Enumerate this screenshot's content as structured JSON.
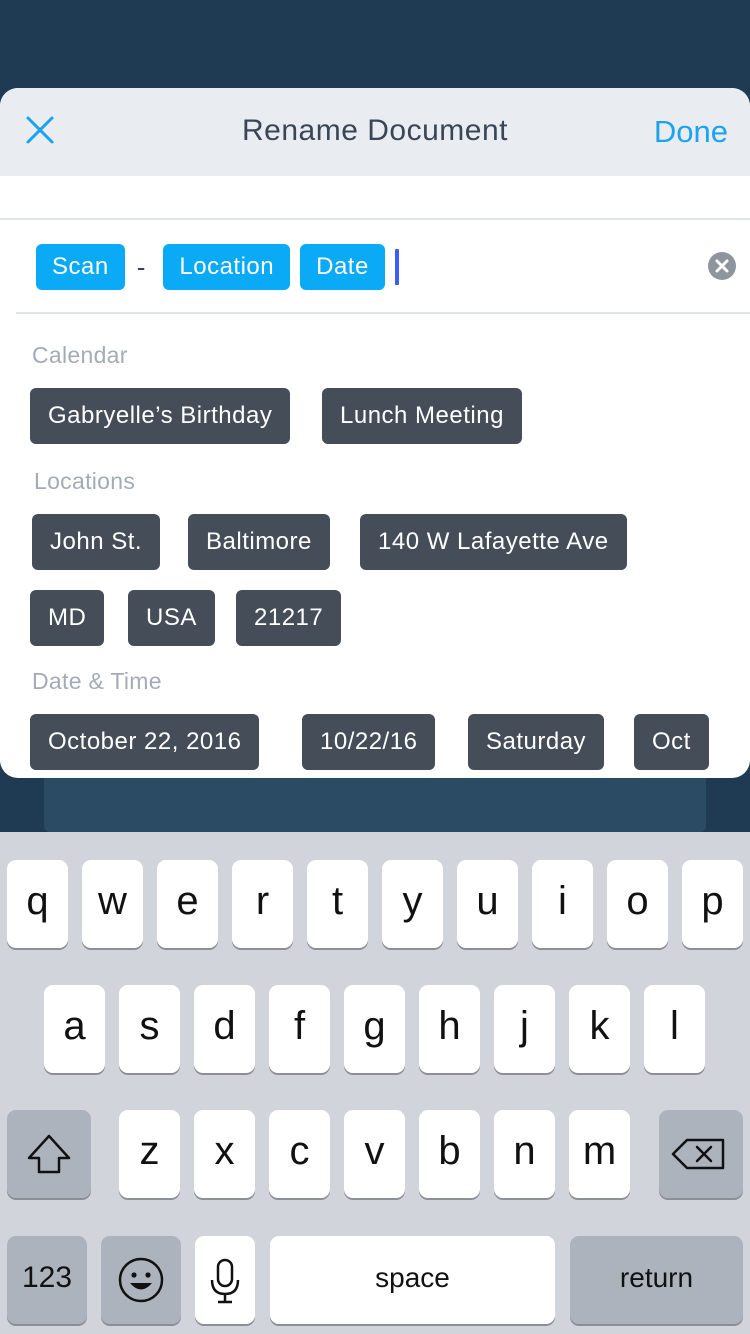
{
  "dialog": {
    "title": "Rename Document",
    "done_label": "Done"
  },
  "tokens": {
    "scan": "Scan",
    "separator": "-",
    "location": "Location",
    "date": "Date"
  },
  "calendar": {
    "label": "Calendar",
    "items": [
      "Gabryelle’s Birthday",
      "Lunch Meeting"
    ]
  },
  "locations": {
    "label": "Locations",
    "items": [
      "John St.",
      "Baltimore",
      "140 W Lafayette Ave",
      "MD",
      "USA",
      "21217"
    ]
  },
  "datetime": {
    "label": "Date & Time",
    "items": [
      "October 22, 2016",
      "10/22/16",
      "Saturday",
      "Oct"
    ]
  },
  "keyboard": {
    "row1": [
      "q",
      "w",
      "e",
      "r",
      "t",
      "y",
      "u",
      "i",
      "o",
      "p"
    ],
    "row2": [
      "a",
      "s",
      "d",
      "f",
      "g",
      "h",
      "j",
      "k",
      "l"
    ],
    "row3": [
      "z",
      "x",
      "c",
      "v",
      "b",
      "n",
      "m"
    ],
    "numbers_label": "123",
    "space_label": "space",
    "return_label": "return"
  },
  "colors": {
    "accent": "#1aa3ef",
    "token": "#0aaaf7",
    "chip": "#454d59"
  }
}
